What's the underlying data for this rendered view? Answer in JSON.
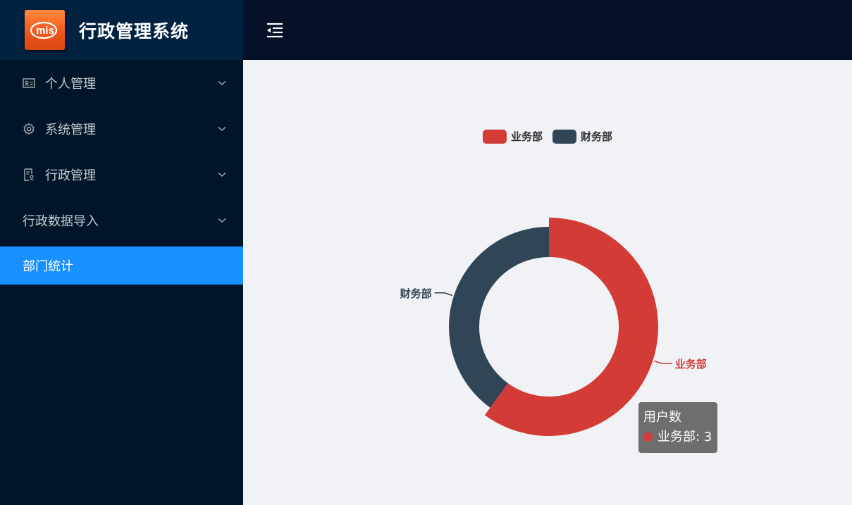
{
  "app": {
    "title": "行政管理系统",
    "logo_text": "mis"
  },
  "sidebar": {
    "items": [
      {
        "label": "个人管理",
        "icon": "id-card-icon",
        "expandable": true
      },
      {
        "label": "系统管理",
        "icon": "gear-icon",
        "expandable": true
      },
      {
        "label": "行政管理",
        "icon": "audit-icon",
        "expandable": true
      },
      {
        "label": "行政数据导入",
        "icon": "",
        "expandable": true
      },
      {
        "label": "部门统计",
        "icon": "",
        "expandable": false,
        "active": true
      }
    ]
  },
  "header": {
    "fold_icon": "menu-fold-icon"
  },
  "colors": {
    "sidebar_bg": "#001529",
    "active": "#1890ff",
    "series_1": "#d33b36",
    "series_2": "#304556"
  },
  "chart_data": {
    "type": "pie",
    "style": "donut",
    "series_name": "用户数",
    "slices": [
      {
        "name": "业务部",
        "value": 3,
        "color": "#d33b36"
      },
      {
        "name": "财务部",
        "value": 2,
        "color": "#304556"
      }
    ],
    "legend": [
      "业务部",
      "财务部"
    ],
    "legend_position": "top-center",
    "tooltip": {
      "title": "用户数",
      "entry": "业务部: 3",
      "color": "#d33b36"
    }
  }
}
